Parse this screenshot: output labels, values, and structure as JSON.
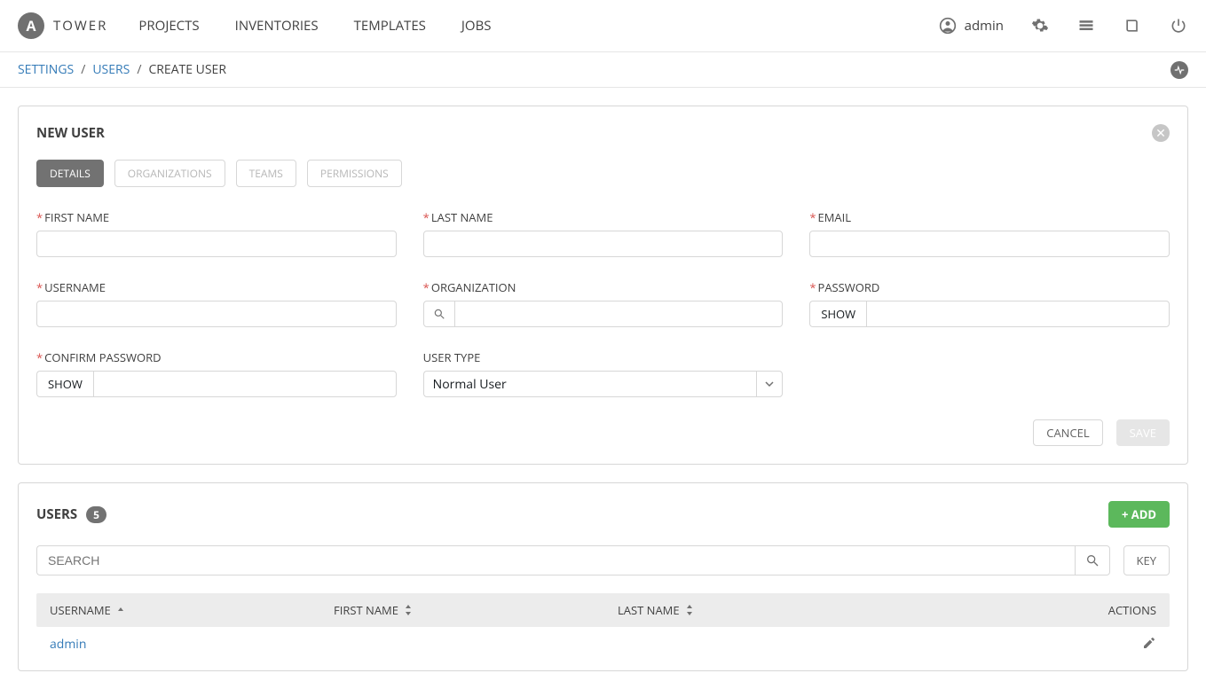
{
  "brand": {
    "logo_letter": "A",
    "text": "TOWER"
  },
  "nav": {
    "projects": "PROJECTS",
    "inventories": "INVENTORIES",
    "templates": "TEMPLATES",
    "jobs": "JOBS",
    "user": "admin"
  },
  "breadcrumb": {
    "settings": "SETTINGS",
    "users": "USERS",
    "create": "CREATE USER"
  },
  "form_panel": {
    "title": "NEW USER",
    "tabs": {
      "details": "DETAILS",
      "organizations": "ORGANIZATIONS",
      "teams": "TEAMS",
      "permissions": "PERMISSIONS"
    },
    "fields": {
      "first_name": "FIRST NAME",
      "last_name": "LAST NAME",
      "email": "EMAIL",
      "username": "USERNAME",
      "organization": "ORGANIZATION",
      "password": "PASSWORD",
      "confirm_password": "CONFIRM PASSWORD",
      "user_type": "USER TYPE",
      "user_type_value": "Normal User",
      "show": "SHOW"
    },
    "actions": {
      "cancel": "CANCEL",
      "save": "SAVE"
    }
  },
  "users_panel": {
    "title": "USERS",
    "count": "5",
    "add": "+ ADD",
    "search_placeholder": "SEARCH",
    "key": "KEY",
    "columns": {
      "username": "USERNAME",
      "first_name": "FIRST NAME",
      "last_name": "LAST NAME",
      "actions": "ACTIONS"
    },
    "rows": [
      {
        "username": "admin",
        "first_name": "",
        "last_name": ""
      }
    ]
  }
}
